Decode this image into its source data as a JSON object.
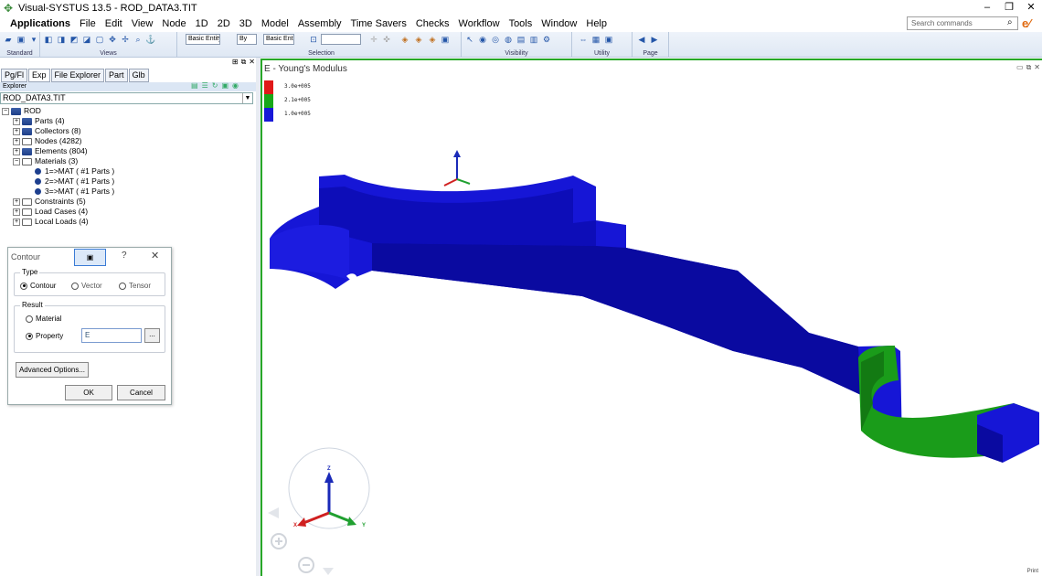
{
  "window": {
    "title": "Visual-SYSTUS 13.5 - ROD_DATA3.TIT",
    "minimize": "–",
    "restore": "❐",
    "close": "✕"
  },
  "menubar": {
    "items": [
      "Applications",
      "File",
      "Edit",
      "View",
      "Node",
      "1D",
      "2D",
      "3D",
      "Model",
      "Assembly",
      "Time Savers",
      "Checks",
      "Workflow",
      "Tools",
      "Window",
      "Help"
    ],
    "search_placeholder": "Search commands"
  },
  "toolbar": {
    "groups": {
      "standard": "Standard",
      "views": "Views",
      "selection": "Selection",
      "visibility": "Visibility",
      "utility": "Utility",
      "page": "Page"
    },
    "select_basic_entity": "Basic Entity",
    "select_by": "By",
    "select_basic_ent": "Basic Ent"
  },
  "leftpanel": {
    "tabs": [
      "Pg/Fl",
      "Exp",
      "File Explorer",
      "Part",
      "Glb"
    ],
    "explorer_label": "Explorer",
    "file": "ROD_DATA3.TIT",
    "tree": {
      "root": "ROD",
      "parts": "Parts (4)",
      "collectors": "Collectors (8)",
      "nodes": "Nodes (4282)",
      "elements": "Elements (804)",
      "materials": "Materials (3)",
      "mat1": "1=>MAT ( #1 Parts )",
      "mat2": "2=>MAT ( #1 Parts )",
      "mat3": "3=>MAT ( #1 Parts )",
      "constraints": "Constraints (5)",
      "loadcases": "Load Cases (4)",
      "locals": "Local Loads (4)"
    }
  },
  "dialog": {
    "title": "Contour",
    "help": "?",
    "close": "✕",
    "type_legend": "Type",
    "opt_contour": "Contour",
    "opt_vector": "Vector",
    "opt_tensor": "Tensor",
    "result_legend": "Result",
    "opt_material": "Material",
    "opt_property": "Property",
    "property_value": "E",
    "browse": "...",
    "advanced": "Advanced Options...",
    "ok": "OK",
    "cancel": "Cancel"
  },
  "viewport": {
    "title": "E - Young's Modulus",
    "legend": [
      {
        "label": "3.0e+005",
        "color": "#e01818"
      },
      {
        "label": "2.1e+005",
        "color": "#18a818"
      },
      {
        "label": "1.0e+005",
        "color": "#1818d8"
      }
    ],
    "triad_z": "Z",
    "triad_x": "X",
    "triad_y": "Y",
    "print_label": "Print"
  },
  "colors": {
    "accent_green": "#28a828",
    "mesh_blue": "#1a1ad0",
    "mesh_green": "#1aa01a"
  }
}
